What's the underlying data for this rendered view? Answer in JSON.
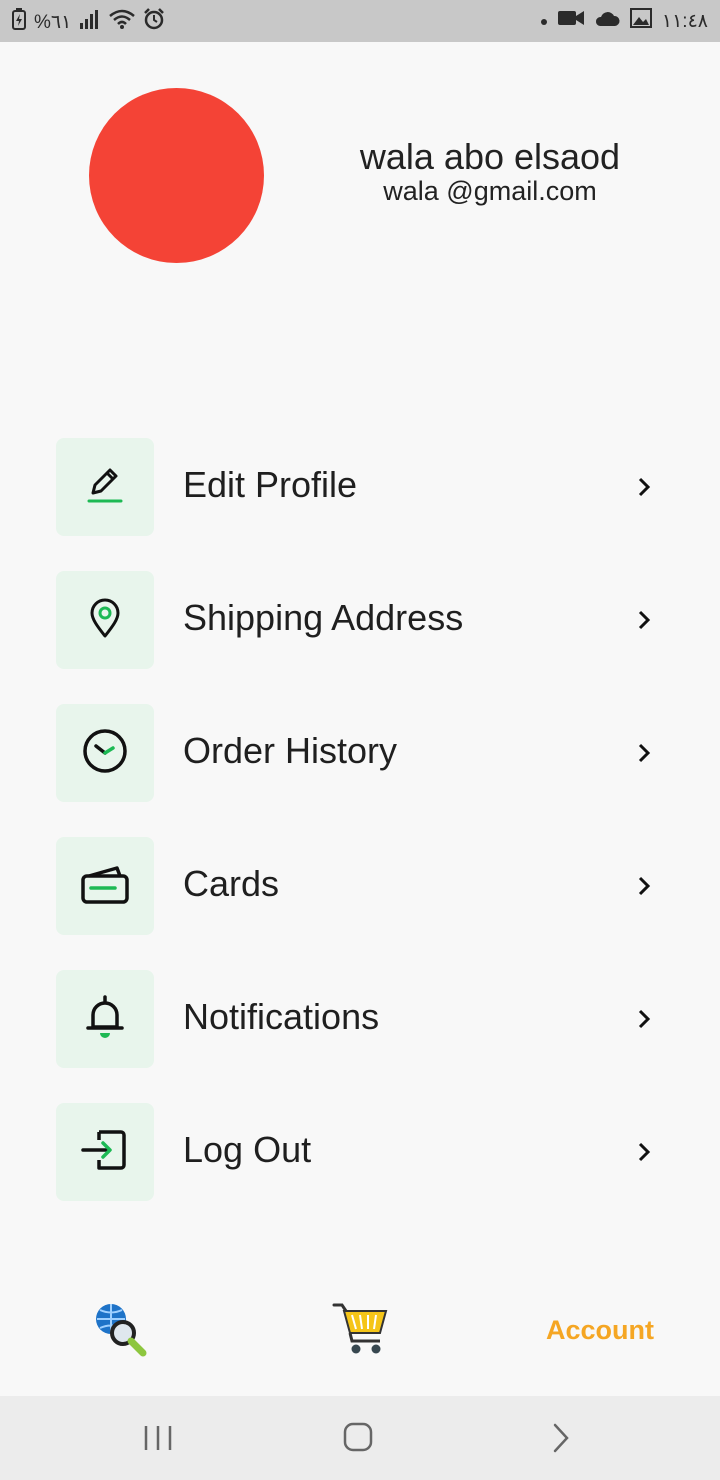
{
  "status_bar": {
    "battery_percent": "%٦١",
    "time": "١١:٤٨",
    "left_icons": [
      "battery-charging-icon",
      "signal-icon",
      "wifi-icon",
      "alarm-icon"
    ],
    "right_icons": [
      "dot-icon",
      "video-icon",
      "cloud-icon",
      "image-icon"
    ]
  },
  "profile": {
    "avatar_color": "#f44336",
    "name": "wala abo elsaod",
    "email": "wala @gmail.com"
  },
  "menu": {
    "items": [
      {
        "label": "Edit Profile",
        "icon": "pencil-icon"
      },
      {
        "label": "Shipping Address",
        "icon": "location-pin-icon"
      },
      {
        "label": "Order History",
        "icon": "clock-icon"
      },
      {
        "label": "Cards",
        "icon": "wallet-card-icon"
      },
      {
        "label": "Notifications",
        "icon": "bell-icon"
      },
      {
        "label": "Log Out",
        "icon": "logout-icon"
      }
    ],
    "icon_bg": "#e8f5ec",
    "accent": "#1db954"
  },
  "bottom_nav": {
    "items": [
      {
        "icon": "globe-search-icon"
      },
      {
        "icon": "cart-icon"
      },
      {
        "label": "Account",
        "color": "#f5a623",
        "active": true
      }
    ]
  },
  "system_nav": {
    "buttons": [
      "recents-icon",
      "home-icon",
      "back-icon"
    ]
  }
}
